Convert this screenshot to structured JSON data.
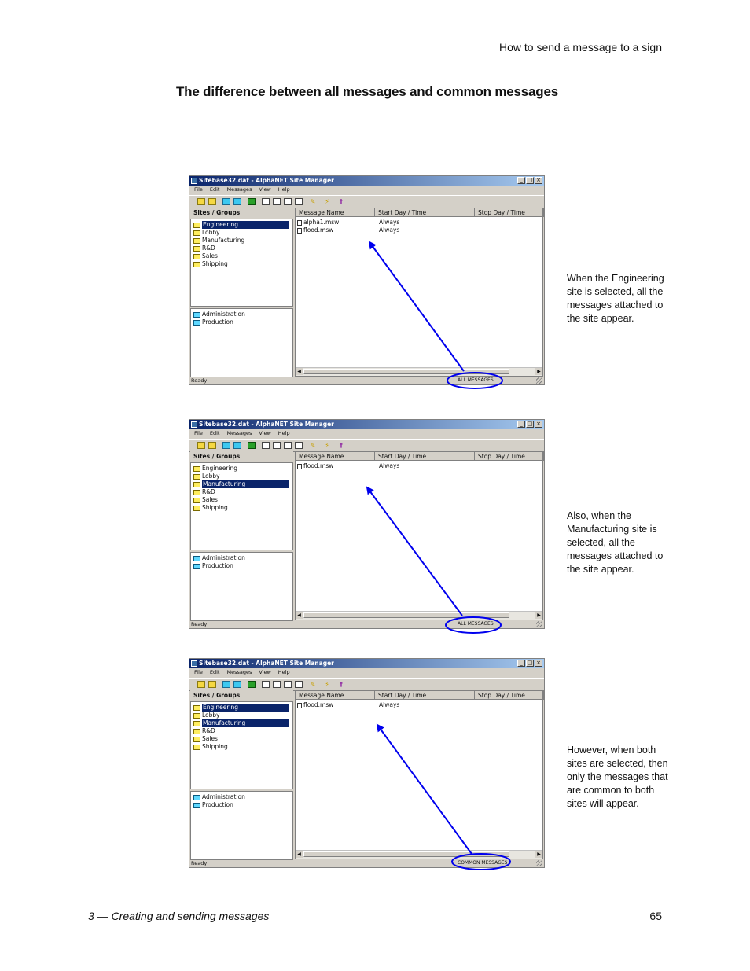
{
  "page": {
    "header_right": "How to send a message to a sign",
    "section_title": "The difference between all messages and common messages",
    "footer_left": "3 — Creating and sending messages",
    "footer_right": "65"
  },
  "colors": {
    "annotation": "#0000ee",
    "title_bar": "#0a246a",
    "selection": "#0a246a"
  },
  "window_common": {
    "title": "Sitebase32.dat - AlphaNET Site Manager",
    "menu": [
      "File",
      "Edit",
      "Messages",
      "View",
      "Help"
    ],
    "sites_header": "Sites / Groups",
    "columns": [
      "Message Name",
      "Start Day / Time",
      "Stop Day / Time"
    ],
    "status_left": "Ready",
    "toolbar_icons": [
      "folder-new-icon",
      "folder-open-icon",
      "group-new-icon",
      "group-open-icon",
      "trash-icon",
      "doc-new-icon",
      "doc-icon",
      "copy-icon",
      "print-icon",
      "edit-pencil-icon",
      "lightning-icon",
      "key-icon"
    ]
  },
  "screenshots": [
    {
      "sites": [
        {
          "label": "Engineering",
          "selected": true
        },
        {
          "label": "Lobby",
          "selected": false
        },
        {
          "label": "Manufacturing",
          "selected": false
        },
        {
          "label": "R&D",
          "selected": false
        },
        {
          "label": "Sales",
          "selected": false
        },
        {
          "label": "Shipping",
          "selected": false
        }
      ],
      "groups": [
        "Administration",
        "Production"
      ],
      "messages": [
        {
          "name": "alpha1.msw",
          "start": "Always"
        },
        {
          "name": "flood.msw",
          "start": "Always"
        }
      ],
      "status_mode": "ALL MESSAGES",
      "caption": "When the Engineering site is selected, all the messages attached to the site appear."
    },
    {
      "sites": [
        {
          "label": "Engineering",
          "selected": false
        },
        {
          "label": "Lobby",
          "selected": false
        },
        {
          "label": "Manufacturing",
          "selected": true
        },
        {
          "label": "R&D",
          "selected": false
        },
        {
          "label": "Sales",
          "selected": false
        },
        {
          "label": "Shipping",
          "selected": false
        }
      ],
      "groups": [
        "Administration",
        "Production"
      ],
      "messages": [
        {
          "name": "flood.msw",
          "start": "Always"
        }
      ],
      "status_mode": "ALL MESSAGES",
      "caption": "Also, when the Manufacturing site is selected, all the messages attached to the site appear."
    },
    {
      "sites": [
        {
          "label": "Engineering",
          "selected": true
        },
        {
          "label": "Lobby",
          "selected": false
        },
        {
          "label": "Manufacturing",
          "selected": true
        },
        {
          "label": "R&D",
          "selected": false
        },
        {
          "label": "Sales",
          "selected": false
        },
        {
          "label": "Shipping",
          "selected": false
        }
      ],
      "groups": [
        "Administration",
        "Production"
      ],
      "messages": [
        {
          "name": "flood.msw",
          "start": "Always"
        }
      ],
      "status_mode": "COMMON MESSAGES",
      "caption": "However, when both sites are selected, then only the messages that are common to both sites will appear."
    }
  ]
}
